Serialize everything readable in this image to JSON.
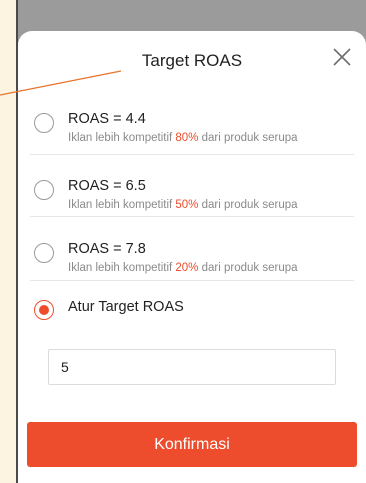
{
  "sheet": {
    "title": "Target ROAS",
    "close_icon": "close-icon"
  },
  "options": [
    {
      "label": "ROAS = 4.4",
      "desc_before": "Iklan lebih kompetitif ",
      "percent": "80%",
      "desc_after": " dari produk serupa",
      "selected": false
    },
    {
      "label": "ROAS = 6.5",
      "desc_before": "Iklan lebih kompetitif ",
      "percent": "50%",
      "desc_after": " dari produk serupa",
      "selected": false
    },
    {
      "label": "ROAS = 7.8",
      "desc_before": "Iklan lebih kompetitif ",
      "percent": "20%",
      "desc_after": " dari produk serupa",
      "selected": false
    },
    {
      "label": "Atur Target ROAS",
      "selected": true
    }
  ],
  "custom_input": {
    "value": "5"
  },
  "confirm_label": "Konfirmasi",
  "colors": {
    "accent": "#ee4d2d",
    "annotation_line": "#e8742c",
    "page_background": "#fdf3e1",
    "overlay": "#9b9b9b"
  }
}
